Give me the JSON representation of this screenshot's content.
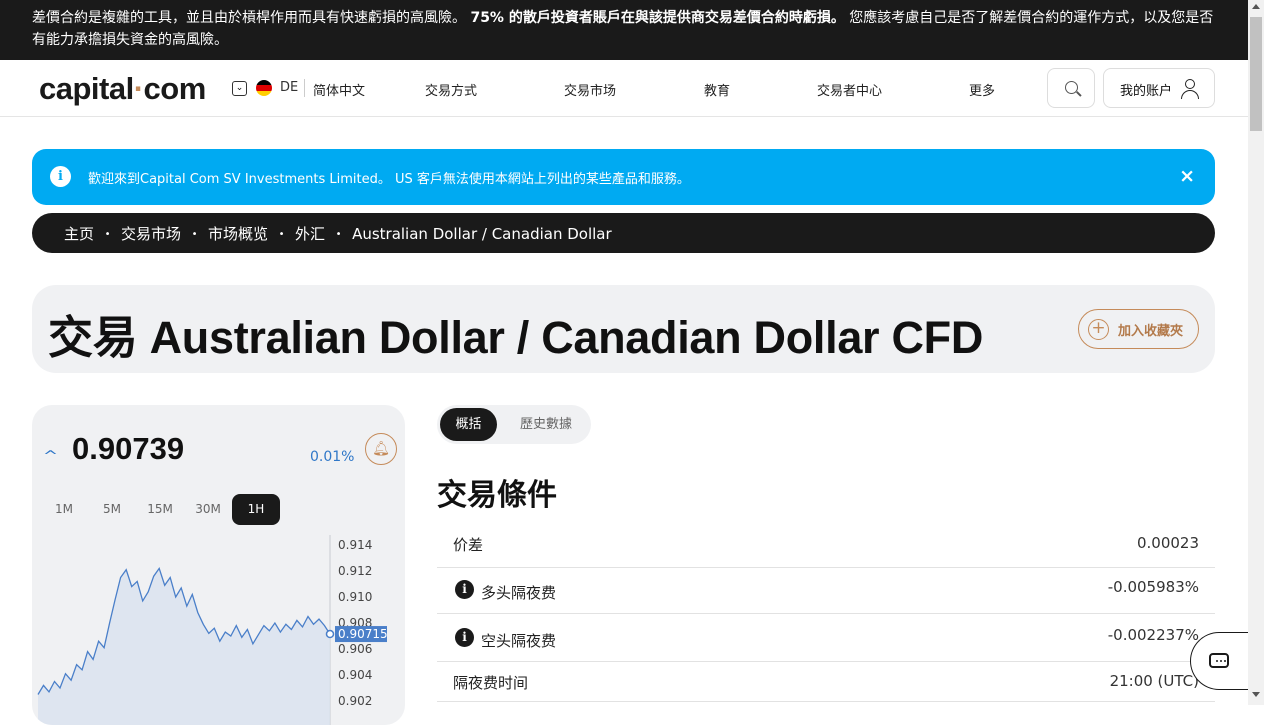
{
  "risk_warning": {
    "part1": "差價合約是複雜的工具，並且由於槓桿作用而具有快速虧損的高風險。",
    "part2_bold": "75% 的散戶投資者賬戶在與該提供商交易差價合約時虧損。",
    "part3": "您應該考慮自己是否了解差價合約的運作方式，以及您是否有能力承擔損失資金的高風險。"
  },
  "header": {
    "logo_left": "capital",
    "logo_dot": "·",
    "logo_right": "com",
    "lang_code": "DE",
    "lang_name": "简体中文",
    "nav": [
      "交易方式",
      "交易市场",
      "教育",
      "交易者中心",
      "更多"
    ],
    "account_label": "我的账户"
  },
  "notice": {
    "text": "歡迎來到Capital Com SV Investments Limited。 US 客戶無法使用本網站上列出的某些產品和服務。",
    "close": "×"
  },
  "breadcrumb": [
    "主页",
    "交易市场",
    "市场概览",
    "外汇",
    "Australian Dollar / Canadian Dollar"
  ],
  "breadcrumb_sep": "•",
  "title": {
    "text": "交易 Australian Dollar / Canadian Dollar CFD",
    "fav_label": "加入收藏夾",
    "fav_icon": "+"
  },
  "quote": {
    "direction_icon": "^",
    "price": "0.90739",
    "change": "0.01%",
    "alert_icon": "bell-icon",
    "timeframes": [
      "1M",
      "5M",
      "15M",
      "30M",
      "1H"
    ],
    "active_timeframe": "1H"
  },
  "chart_data": {
    "type": "area",
    "yticks": [
      "0.914",
      "0.912",
      "0.910",
      "0.908",
      "0.906",
      "0.904",
      "0.902"
    ],
    "ylim": [
      0.902,
      0.914
    ],
    "current_label": "0.90715",
    "values": [
      0.9025,
      0.9032,
      0.9027,
      0.9035,
      0.903,
      0.9041,
      0.9036,
      0.9048,
      0.9044,
      0.9058,
      0.9052,
      0.9066,
      0.9061,
      0.908,
      0.9098,
      0.9115,
      0.9121,
      0.9108,
      0.9112,
      0.9097,
      0.9104,
      0.9116,
      0.9122,
      0.9109,
      0.9115,
      0.91,
      0.9107,
      0.9093,
      0.9102,
      0.9088,
      0.9079,
      0.9072,
      0.9076,
      0.9066,
      0.9073,
      0.907,
      0.9078,
      0.9069,
      0.9075,
      0.9064,
      0.9071,
      0.9078,
      0.9074,
      0.908,
      0.9073,
      0.9079,
      0.9075,
      0.9082,
      0.9077,
      0.9085,
      0.9079,
      0.9083,
      0.9078,
      0.90715
    ],
    "line_color": "#4a7fc9",
    "fill_color": "#d9e2ef"
  },
  "tabs": [
    "概括",
    "歷史數據"
  ],
  "section_title": "交易條件",
  "conditions": [
    {
      "label": "价差",
      "value": "0.00023",
      "info": false
    },
    {
      "label": "多头隔夜费",
      "value": "-0.005983%",
      "info": true
    },
    {
      "label": "空头隔夜费",
      "value": "-0.002237%",
      "info": true
    },
    {
      "label": "隔夜费时间",
      "value": "21:00 (UTC)",
      "info": false
    }
  ],
  "colors": {
    "accent_blue": "#00aaf2",
    "dark": "#1a1a1a",
    "brand_copper": "#c58b5a",
    "price_blue": "#2f77c8"
  }
}
